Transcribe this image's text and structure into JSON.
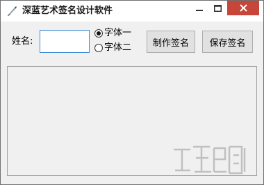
{
  "window": {
    "title": "深蓝艺术签名设计软件"
  },
  "form": {
    "name_label": "姓名:",
    "name_value": "",
    "radio_options": [
      {
        "label": "字体一",
        "checked": true
      },
      {
        "label": "字体二",
        "checked": false
      }
    ],
    "make_button": "制作签名",
    "save_button": "保存签名"
  },
  "colors": {
    "close_button": "#c7463a",
    "input_border": "#3f8bd2",
    "window_bg": "#f0f0f0"
  },
  "icons": {
    "app": "pen-icon",
    "minimize": "minimize-icon",
    "maximize": "maximize-icon",
    "close": "close-icon",
    "watermark": "watermark-logo"
  }
}
